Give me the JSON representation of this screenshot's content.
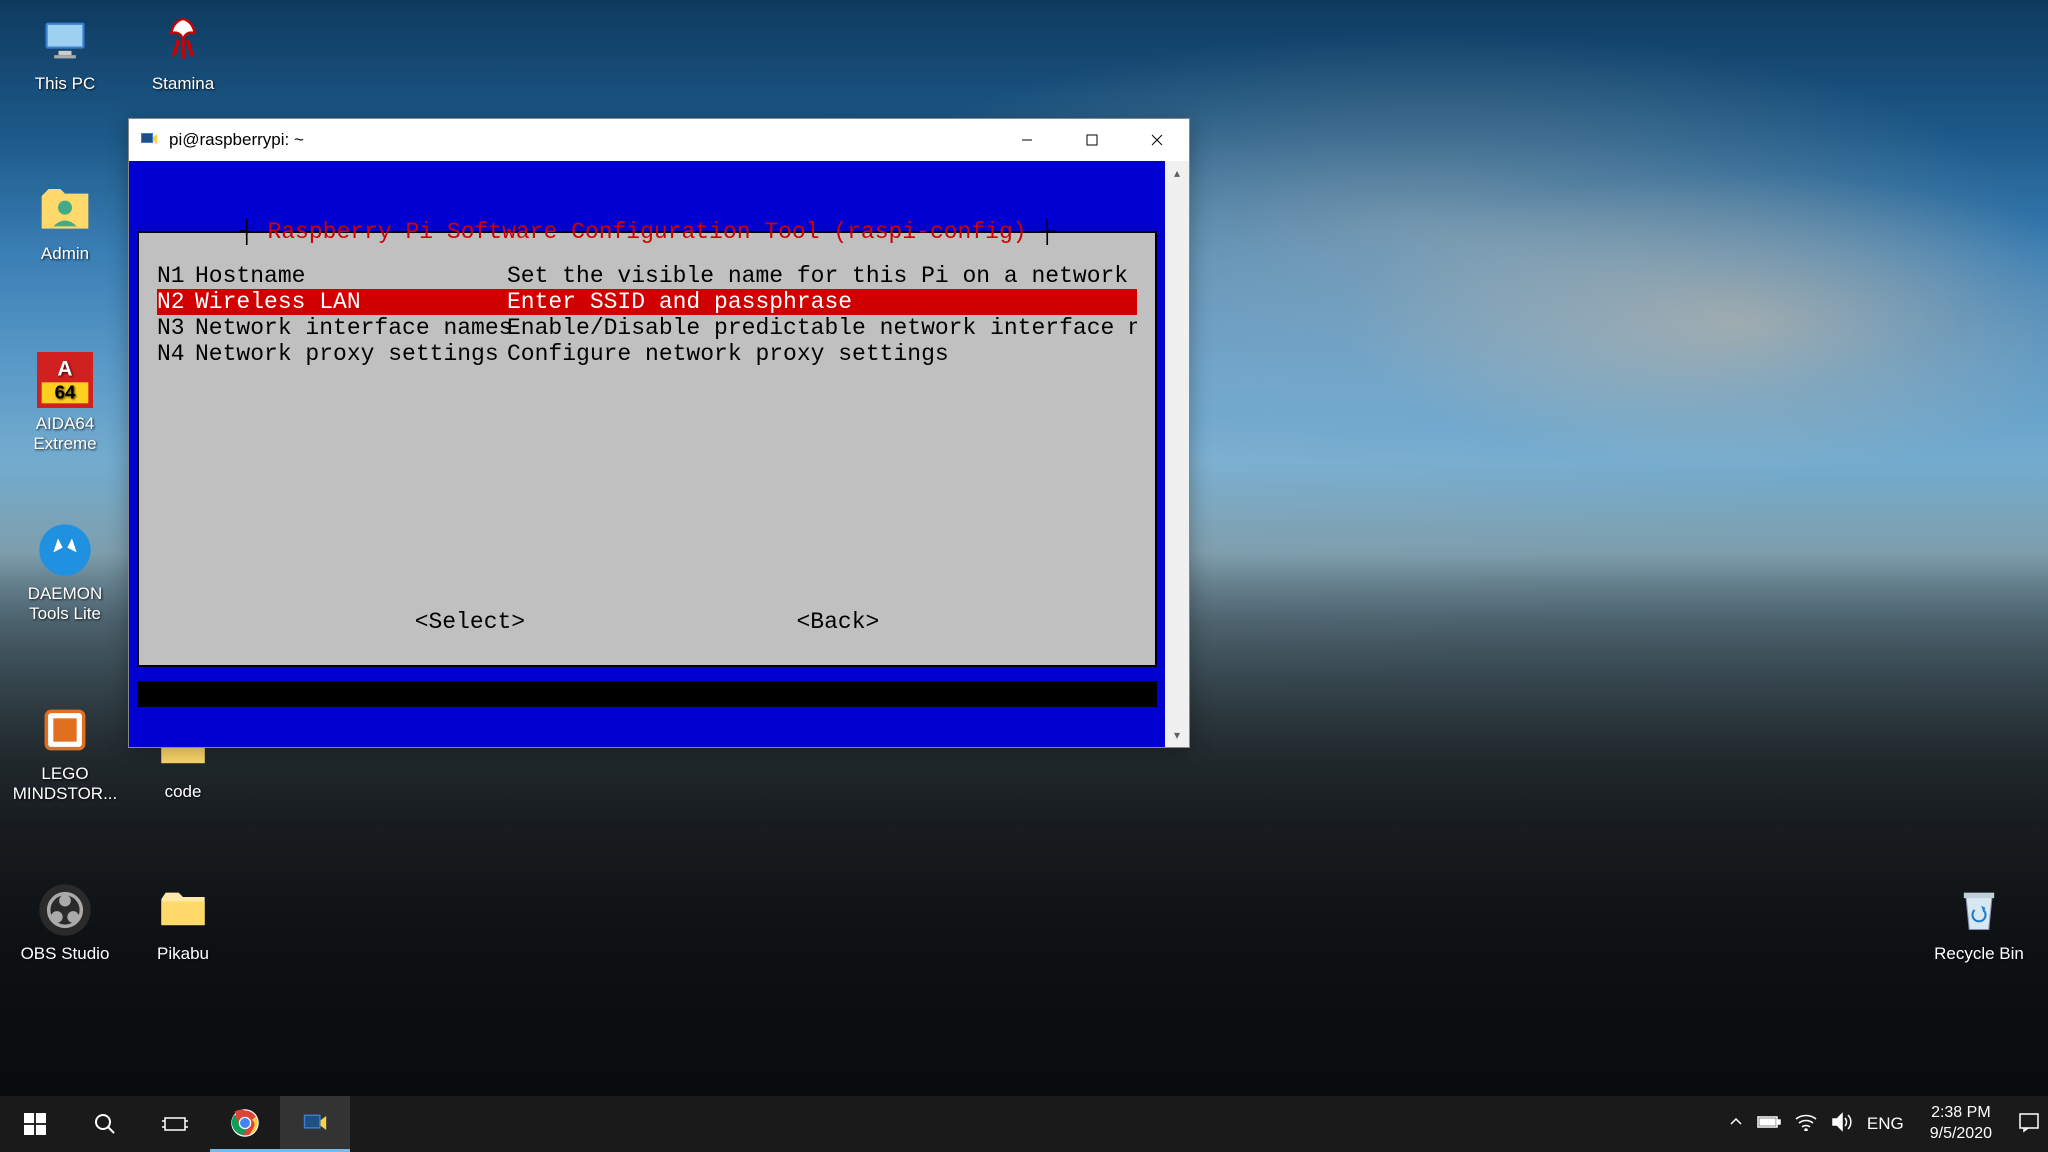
{
  "desktop_icons": {
    "col1": [
      {
        "name": "this-pc",
        "label": "This PC"
      },
      {
        "name": "admin",
        "label": "Admin"
      },
      {
        "name": "aida64",
        "label": "AIDA64 Extreme"
      },
      {
        "name": "daemon",
        "label": "DAEMON Tools Lite"
      },
      {
        "name": "lego",
        "label": "LEGO MINDSTOR..."
      },
      {
        "name": "obs",
        "label": "OBS Studio"
      }
    ],
    "col2": [
      {
        "name": "stamina",
        "label": "Stamina"
      },
      {
        "name": "code",
        "label": "code"
      },
      {
        "name": "pikabu",
        "label": "Pikabu"
      }
    ],
    "recycle": {
      "label": "Recycle Bin"
    }
  },
  "window": {
    "title": "pi@raspberrypi: ~"
  },
  "config": {
    "title": "Raspberry Pi Software Configuration Tool (raspi-config)",
    "items": [
      {
        "code": "N1",
        "label": "Hostname",
        "desc": "Set the visible name for this Pi on a network",
        "selected": false
      },
      {
        "code": "N2",
        "label": "Wireless LAN",
        "desc": "Enter SSID and passphrase",
        "selected": true
      },
      {
        "code": "N3",
        "label": "Network interface names",
        "desc": "Enable/Disable predictable network interface na",
        "selected": false
      },
      {
        "code": "N4",
        "label": "Network proxy settings",
        "desc": "Configure network proxy settings",
        "selected": false
      }
    ],
    "select_btn": "<Select>",
    "back_btn": "<Back>"
  },
  "taskbar": {
    "lang": "ENG",
    "time": "2:38 PM",
    "date": "9/5/2020"
  }
}
